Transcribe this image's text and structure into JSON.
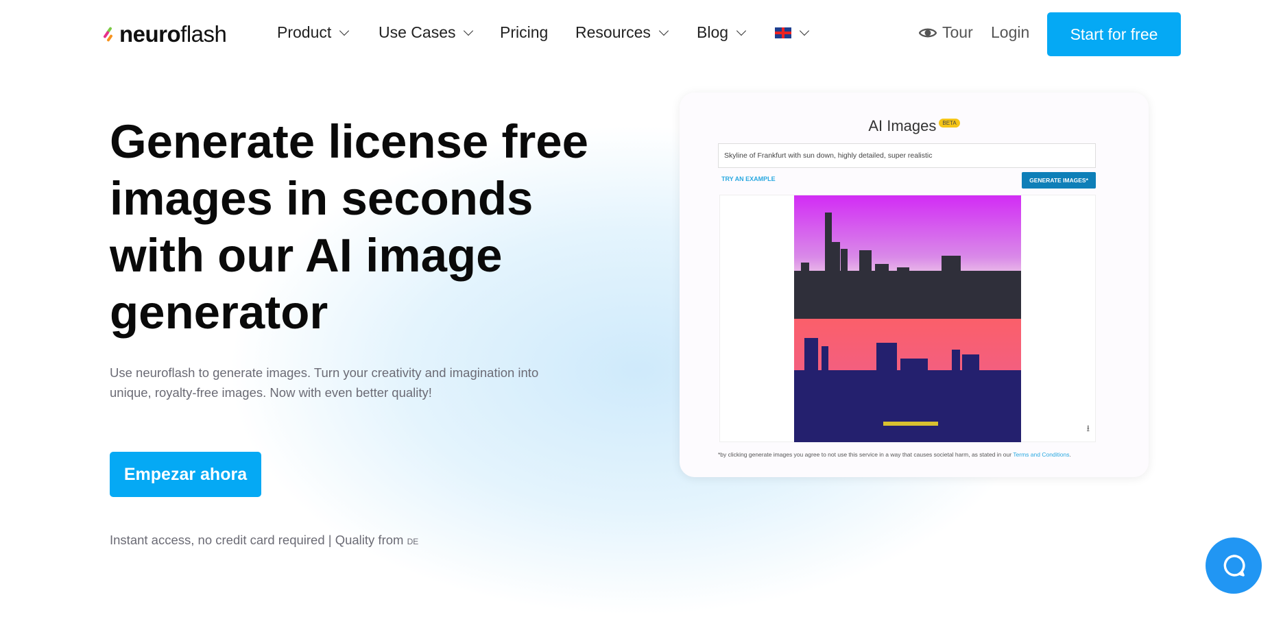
{
  "header": {
    "logo": {
      "bold": "neuro",
      "light": "flash"
    },
    "nav": [
      {
        "label": "Product",
        "dropdown": true
      },
      {
        "label": "Use Cases",
        "dropdown": true
      },
      {
        "label": "Pricing",
        "dropdown": false
      },
      {
        "label": "Resources",
        "dropdown": true
      },
      {
        "label": "Blog",
        "dropdown": true
      }
    ],
    "language_icon": "uk-flag-icon",
    "tour_label": "Tour",
    "login_label": "Login",
    "start_label": "Start for free"
  },
  "hero": {
    "title": "Generate license free images in seconds with our AI image generator",
    "subtitle": "Use neuroflash to generate images. Turn your creativity and imagination into unique, royalty-free images. Now with even better quality!",
    "cta_label": "Empezar ahora",
    "note": "Instant access, no credit card required | Quality from",
    "note_suffix": "DE"
  },
  "demo": {
    "title": "AI Images",
    "badge": "BETA",
    "prompt": "Skyline of Frankfurt with sun down, highly detailed, super realistic",
    "try_label": "TRY AN EXAMPLE",
    "generate_label": "GENERATE IMAGES*",
    "disclaimer": "*by clicking generate images you agree to not use this service in a way that causes societal harm, as stated in our",
    "terms_label": "Terms and Conditions",
    "disclaimer_end": "."
  },
  "colors": {
    "accent": "#05a9f4",
    "beta": "#f5c518",
    "chat": "#2196f3"
  }
}
